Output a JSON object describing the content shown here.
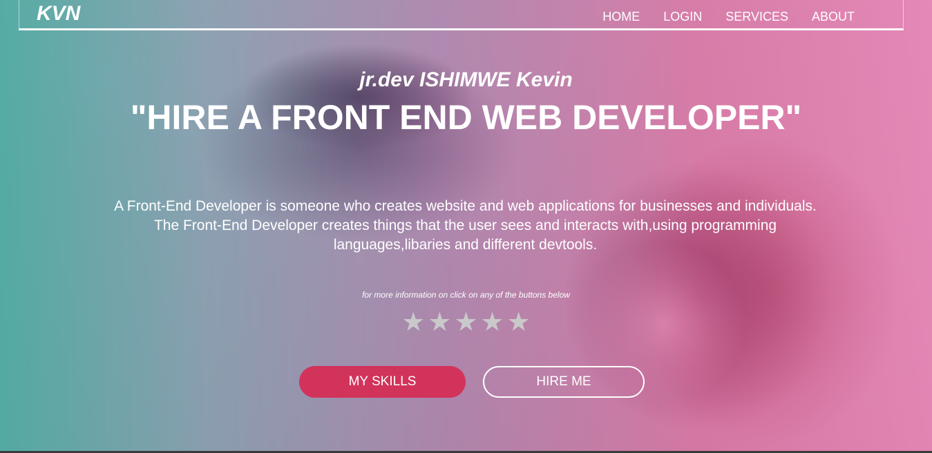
{
  "nav": {
    "logo": "KVN",
    "links": [
      "HOME",
      "LOGIN",
      "SERVICES",
      "ABOUT"
    ]
  },
  "hero": {
    "subtitle": "jr.dev ISHIMWE Kevin",
    "headline": "\"HIRE A FRONT END WEB DEVELOPER\"",
    "description_1": "A Front-End Developer is someone who creates website and web applications for businesses and individuals.",
    "description_2": "The Front-End Developer creates things that the user sees and interacts with,using programming languages,libaries and different devtools.",
    "note": "for more information on click on any of the buttons below",
    "rating": {
      "stars_total": 5,
      "icon": "star-icon",
      "color": "#c9c9c9"
    }
  },
  "buttons": {
    "skills_label": "MY SKILLS",
    "hire_label": "HIRE ME"
  },
  "colors": {
    "accent": "#d2335b",
    "text": "#ffffff"
  }
}
